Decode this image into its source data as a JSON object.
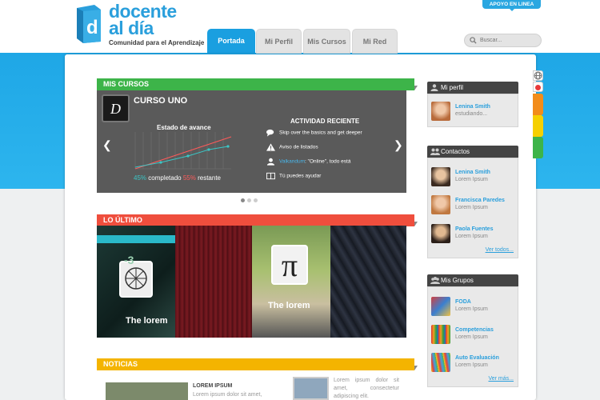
{
  "brand": {
    "line1": "docente",
    "line2": "al día",
    "tagline": "Comunidad para el Aprendizaje",
    "color": "#2a9fdc"
  },
  "support": {
    "label": "APOYO EN LINEA"
  },
  "nav": {
    "tabs": [
      {
        "label": "Portada",
        "active": true
      },
      {
        "label": "Mi Perfil",
        "active": false
      },
      {
        "label": "Mis Cursos",
        "active": false
      },
      {
        "label": "Mi Red",
        "active": false
      }
    ]
  },
  "search": {
    "placeholder": "Buscar..."
  },
  "courses": {
    "section_title": "MIS CURSOS",
    "course_title": "CURSO UNO",
    "progress_title": "Estado de avance",
    "completed_pct": "45%",
    "completed_label": "completado",
    "remaining_pct": "55%",
    "remaining_label": "restante",
    "activity_title": "ACTIVIDAD RECIENTE",
    "activities": [
      {
        "icon": "chat-bubbles-icon",
        "text": "Skip over the basics and get deeper"
      },
      {
        "icon": "warning-icon",
        "text": "Aviso de listados"
      },
      {
        "icon": "user-icon",
        "user": "Valkandum",
        "text": "\"Online\", todo está"
      },
      {
        "icon": "book-icon",
        "text": "Tú puedes ayudar"
      }
    ]
  },
  "latest": {
    "section_title": "LO ÚLTIMO",
    "items": [
      {
        "caption": "The lorem",
        "icon": "network-sphere-icon"
      },
      {
        "caption": "",
        "icon": "red-texture"
      },
      {
        "caption": "The lorem",
        "icon": "pi-icon"
      },
      {
        "caption": "",
        "icon": "dark-stripes"
      }
    ]
  },
  "news": {
    "section_title": "NOTICIAS",
    "items": [
      {
        "title": "LOREM IPSUM",
        "text": "Lorem ipsum dolor sit amet,"
      },
      {
        "title": "",
        "text": "Lorem ipsum dolor sit amet, consectetur adipiscing elit."
      }
    ]
  },
  "profile": {
    "title": "Mi perfil",
    "name": "Lenina Smith",
    "sub": "estudiando..."
  },
  "contacts": {
    "title": "Contactos",
    "items": [
      {
        "name": "Lenina Smith",
        "sub": "Lorem Ipsum"
      },
      {
        "name": "Francisca Paredes",
        "sub": "Lorem Ipsum"
      },
      {
        "name": "Paola Fuentes",
        "sub": "Lorem Ipsum"
      }
    ],
    "more": "Ver todos..."
  },
  "groups": {
    "title": "Mis Grupos",
    "items": [
      {
        "name": "FODA",
        "sub": "Lorem Ipsum"
      },
      {
        "name": "Competencias",
        "sub": "Lorem Ipsum"
      },
      {
        "name": "Auto Evaluación",
        "sub": "Lorem Ipsum"
      }
    ],
    "more": "Ver más..."
  },
  "side_tabs": [
    {
      "icon": "globe-icon",
      "color": "#ffffff"
    },
    {
      "icon": "badge",
      "color": "#ffffff"
    },
    {
      "icon": "",
      "color": "#f28c1a"
    },
    {
      "icon": "",
      "color": "#f5d000"
    },
    {
      "icon": "",
      "color": "#3db449"
    }
  ]
}
